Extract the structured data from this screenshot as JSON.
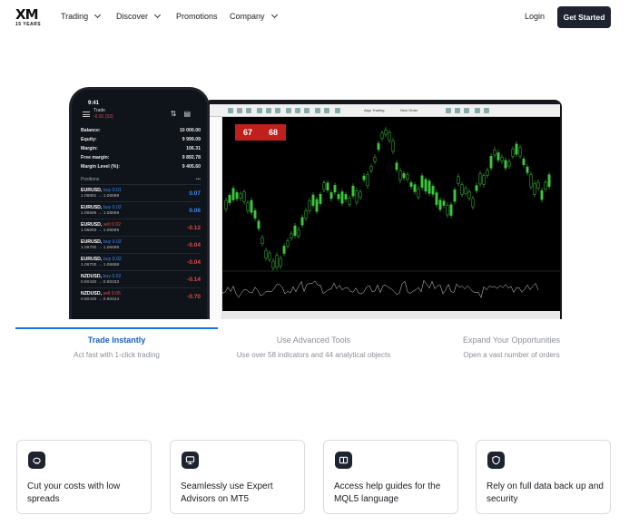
{
  "nav": {
    "logo_text": "XM",
    "logo_sub": "15 YEARS",
    "items": [
      {
        "label": "Trading",
        "dropdown": true
      },
      {
        "label": "Discover",
        "dropdown": true
      },
      {
        "label": "Promotions",
        "dropdown": false
      },
      {
        "label": "Company",
        "dropdown": true
      }
    ],
    "login": "Login",
    "cta": "Get Started"
  },
  "phone": {
    "time": "9:41",
    "title": "Trade",
    "profit": "-0.91 (53)",
    "summary": [
      {
        "label": "Balance:",
        "value": "10 000.00"
      },
      {
        "label": "Equity:",
        "value": "9 999.09"
      },
      {
        "label": "Margin:",
        "value": "106.31"
      },
      {
        "label": "Free margin:",
        "value": "9 892.78"
      },
      {
        "label": "Margin Level (%):",
        "value": "9 405.60"
      }
    ],
    "positions_label": "Positions",
    "positions_more": "•••",
    "positions": [
      {
        "symbol": "EURUSD,",
        "side": "buy 0.01",
        "dir": "buy",
        "prices": "1.06891 → 1.06698",
        "pl": "0.07",
        "sign": "pos"
      },
      {
        "symbol": "EURUSD,",
        "side": "buy 0.02",
        "dir": "buy",
        "prices": "1.06595 → 1.06698",
        "pl": "0.06",
        "sign": "pos"
      },
      {
        "symbol": "EURUSD,",
        "side": "sell 0.02",
        "dir": "sell",
        "prices": "1.06693 → 1.06695",
        "pl": "-0.12",
        "sign": "neg"
      },
      {
        "symbol": "EURUSD,",
        "side": "buy 0.02",
        "dir": "buy",
        "prices": "1.06700 → 1.06698",
        "pl": "-0.04",
        "sign": "neg"
      },
      {
        "symbol": "EURUSD,",
        "side": "buy 0.02",
        "dir": "buy",
        "prices": "1.06700 → 1.06698",
        "pl": "-0.04",
        "sign": "neg"
      },
      {
        "symbol": "NZDUSD,",
        "side": "buy 0.02",
        "dir": "buy",
        "prices": "0.60440 → 0.60433",
        "pl": "-0.14",
        "sign": "neg"
      },
      {
        "symbol": "NZDUSD,",
        "side": "sell 0.05",
        "dir": "sell",
        "prices": "0.60430 → 0.60444",
        "pl": "-0.70",
        "sign": "neg"
      }
    ]
  },
  "terminal": {
    "trade_left": "67",
    "trade_right": "68",
    "toolbar_labels": [
      "Algo Trading",
      "New Order"
    ]
  },
  "tabs": [
    {
      "title": "Trade Instantly",
      "subtitle": "Act fast with 1-click trading",
      "active": true
    },
    {
      "title": "Use Advanced Tools",
      "subtitle": "Use over 58 indicators and 44 analytical objects",
      "active": false
    },
    {
      "title": "Expand Your Opportunities",
      "subtitle": "Open a vast number of orders",
      "active": false
    }
  ],
  "cards": [
    {
      "icon": "piggy-bank-icon",
      "text": "Cut your costs with low spreads"
    },
    {
      "icon": "monitor-icon",
      "text": "Seamlessly use Expert Advisors on MT5"
    },
    {
      "icon": "book-icon",
      "text": "Access help guides for the MQL5 language"
    },
    {
      "icon": "shield-icon",
      "text": "Rely on full data back up and security"
    }
  ],
  "colors": {
    "dark": "#1d232f",
    "accent": "#1a73e8",
    "loss": "#e24a4a",
    "gain": "#3d8bf5",
    "candle": "#3cc83c"
  }
}
